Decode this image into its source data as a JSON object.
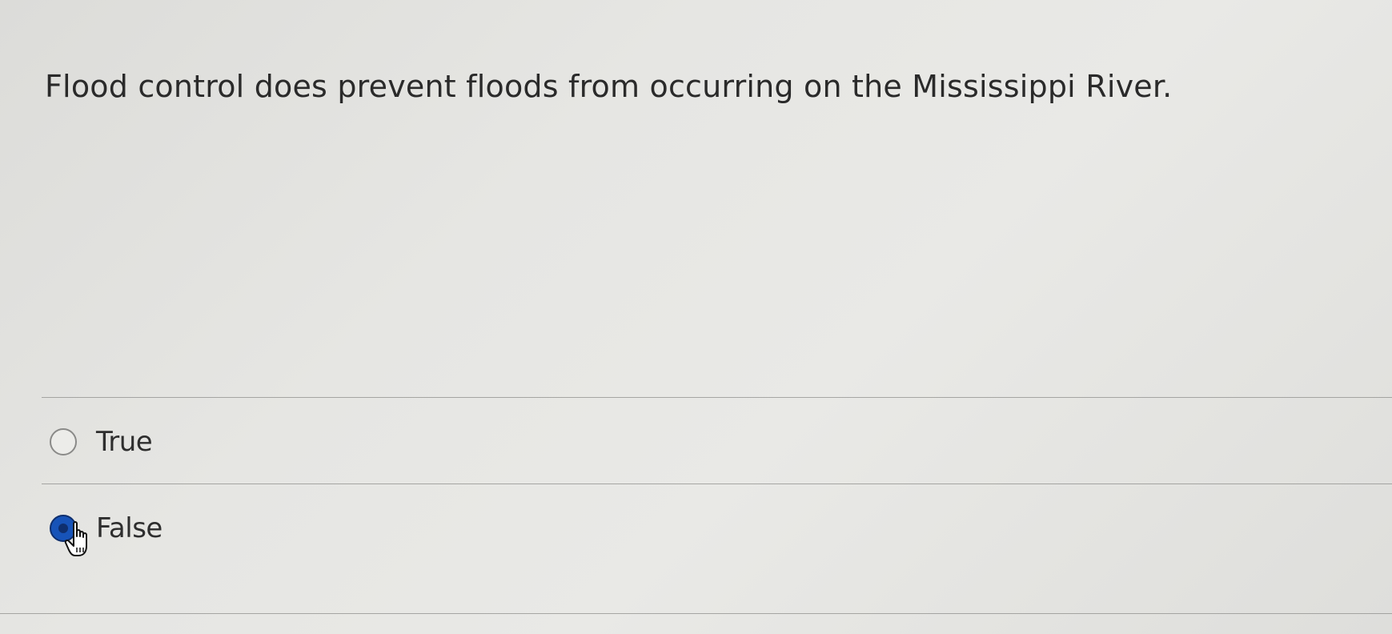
{
  "question": {
    "text": "Flood control does prevent floods from occurring on the Mississippi River."
  },
  "options": [
    {
      "label": "True",
      "selected": false
    },
    {
      "label": "False",
      "selected": true
    }
  ],
  "colors": {
    "selected_radio": "#1753b8",
    "divider": "#8f8f8c",
    "background": "#e6e6e3"
  },
  "icons": {
    "cursor": "hand-pointer-icon"
  }
}
